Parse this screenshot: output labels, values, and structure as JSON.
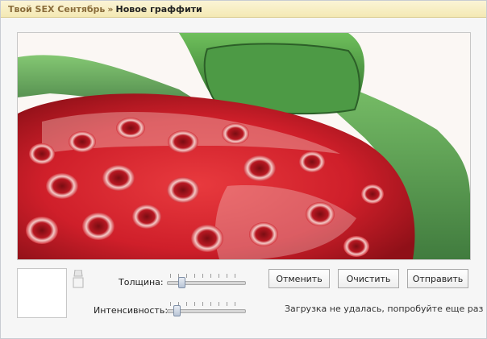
{
  "header": {
    "breadcrumb_link": "Твой SEX Сентябрь",
    "separator": "»",
    "page_title": "Новое граффити"
  },
  "controls": {
    "thickness_label": "Толщина:",
    "intensity_label": "Интенсивность:",
    "thickness_value": 0.16,
    "intensity_value": 0.09
  },
  "buttons": {
    "cancel": "Отменить",
    "clear": "Очистить",
    "send": "Отправить"
  },
  "status": {
    "message": "Загрузка не удалась, попробуйте еще раз"
  },
  "colors": {
    "strawberry_red": "#d9222e",
    "leaf_green": "#3f8f3a",
    "header_bg": "#f4e9b4"
  }
}
